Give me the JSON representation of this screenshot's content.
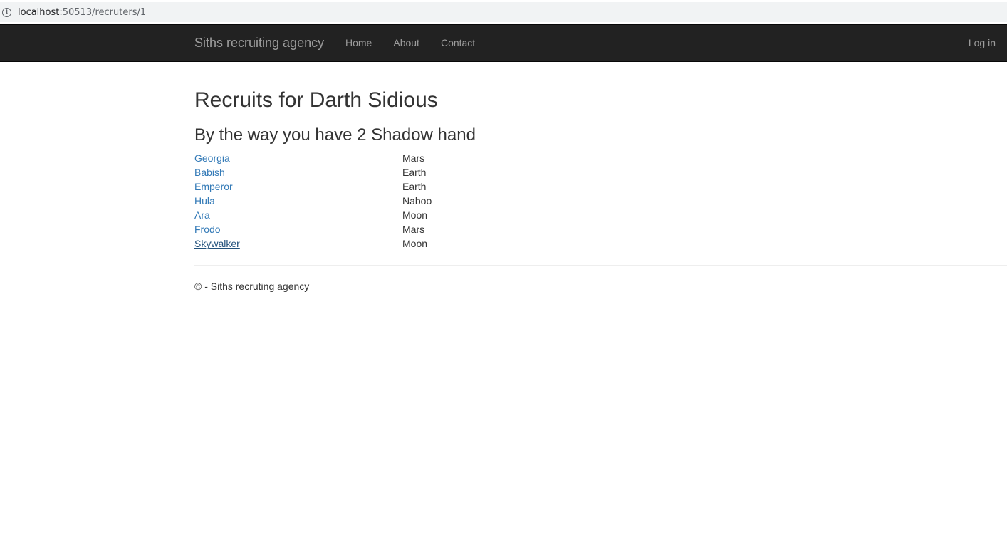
{
  "browser": {
    "url_host": "localhost",
    "url_path": ":50513/recruters/1"
  },
  "navbar": {
    "brand": "Siths recruiting agency",
    "links": [
      "Home",
      "About",
      "Contact"
    ],
    "login": "Log in"
  },
  "main": {
    "title": "Recruits for Darth Sidious",
    "subtitle": "By the way you have 2 Shadow hand",
    "recruits": [
      {
        "name": "Georgia",
        "planet": "Mars"
      },
      {
        "name": "Babish",
        "planet": "Earth"
      },
      {
        "name": "Emperor",
        "planet": "Earth"
      },
      {
        "name": "Hula",
        "planet": "Naboo"
      },
      {
        "name": "Ara",
        "planet": "Moon"
      },
      {
        "name": "Frodo",
        "planet": "Mars"
      },
      {
        "name": "Skywalker",
        "planet": "Moon"
      }
    ]
  },
  "footer": {
    "text": "© - Siths recruting agency"
  },
  "colors": {
    "navbar_bg": "#222222",
    "nav_text": "#9d9d9d",
    "link": "#337ab7",
    "link_hover": "#23527c"
  }
}
